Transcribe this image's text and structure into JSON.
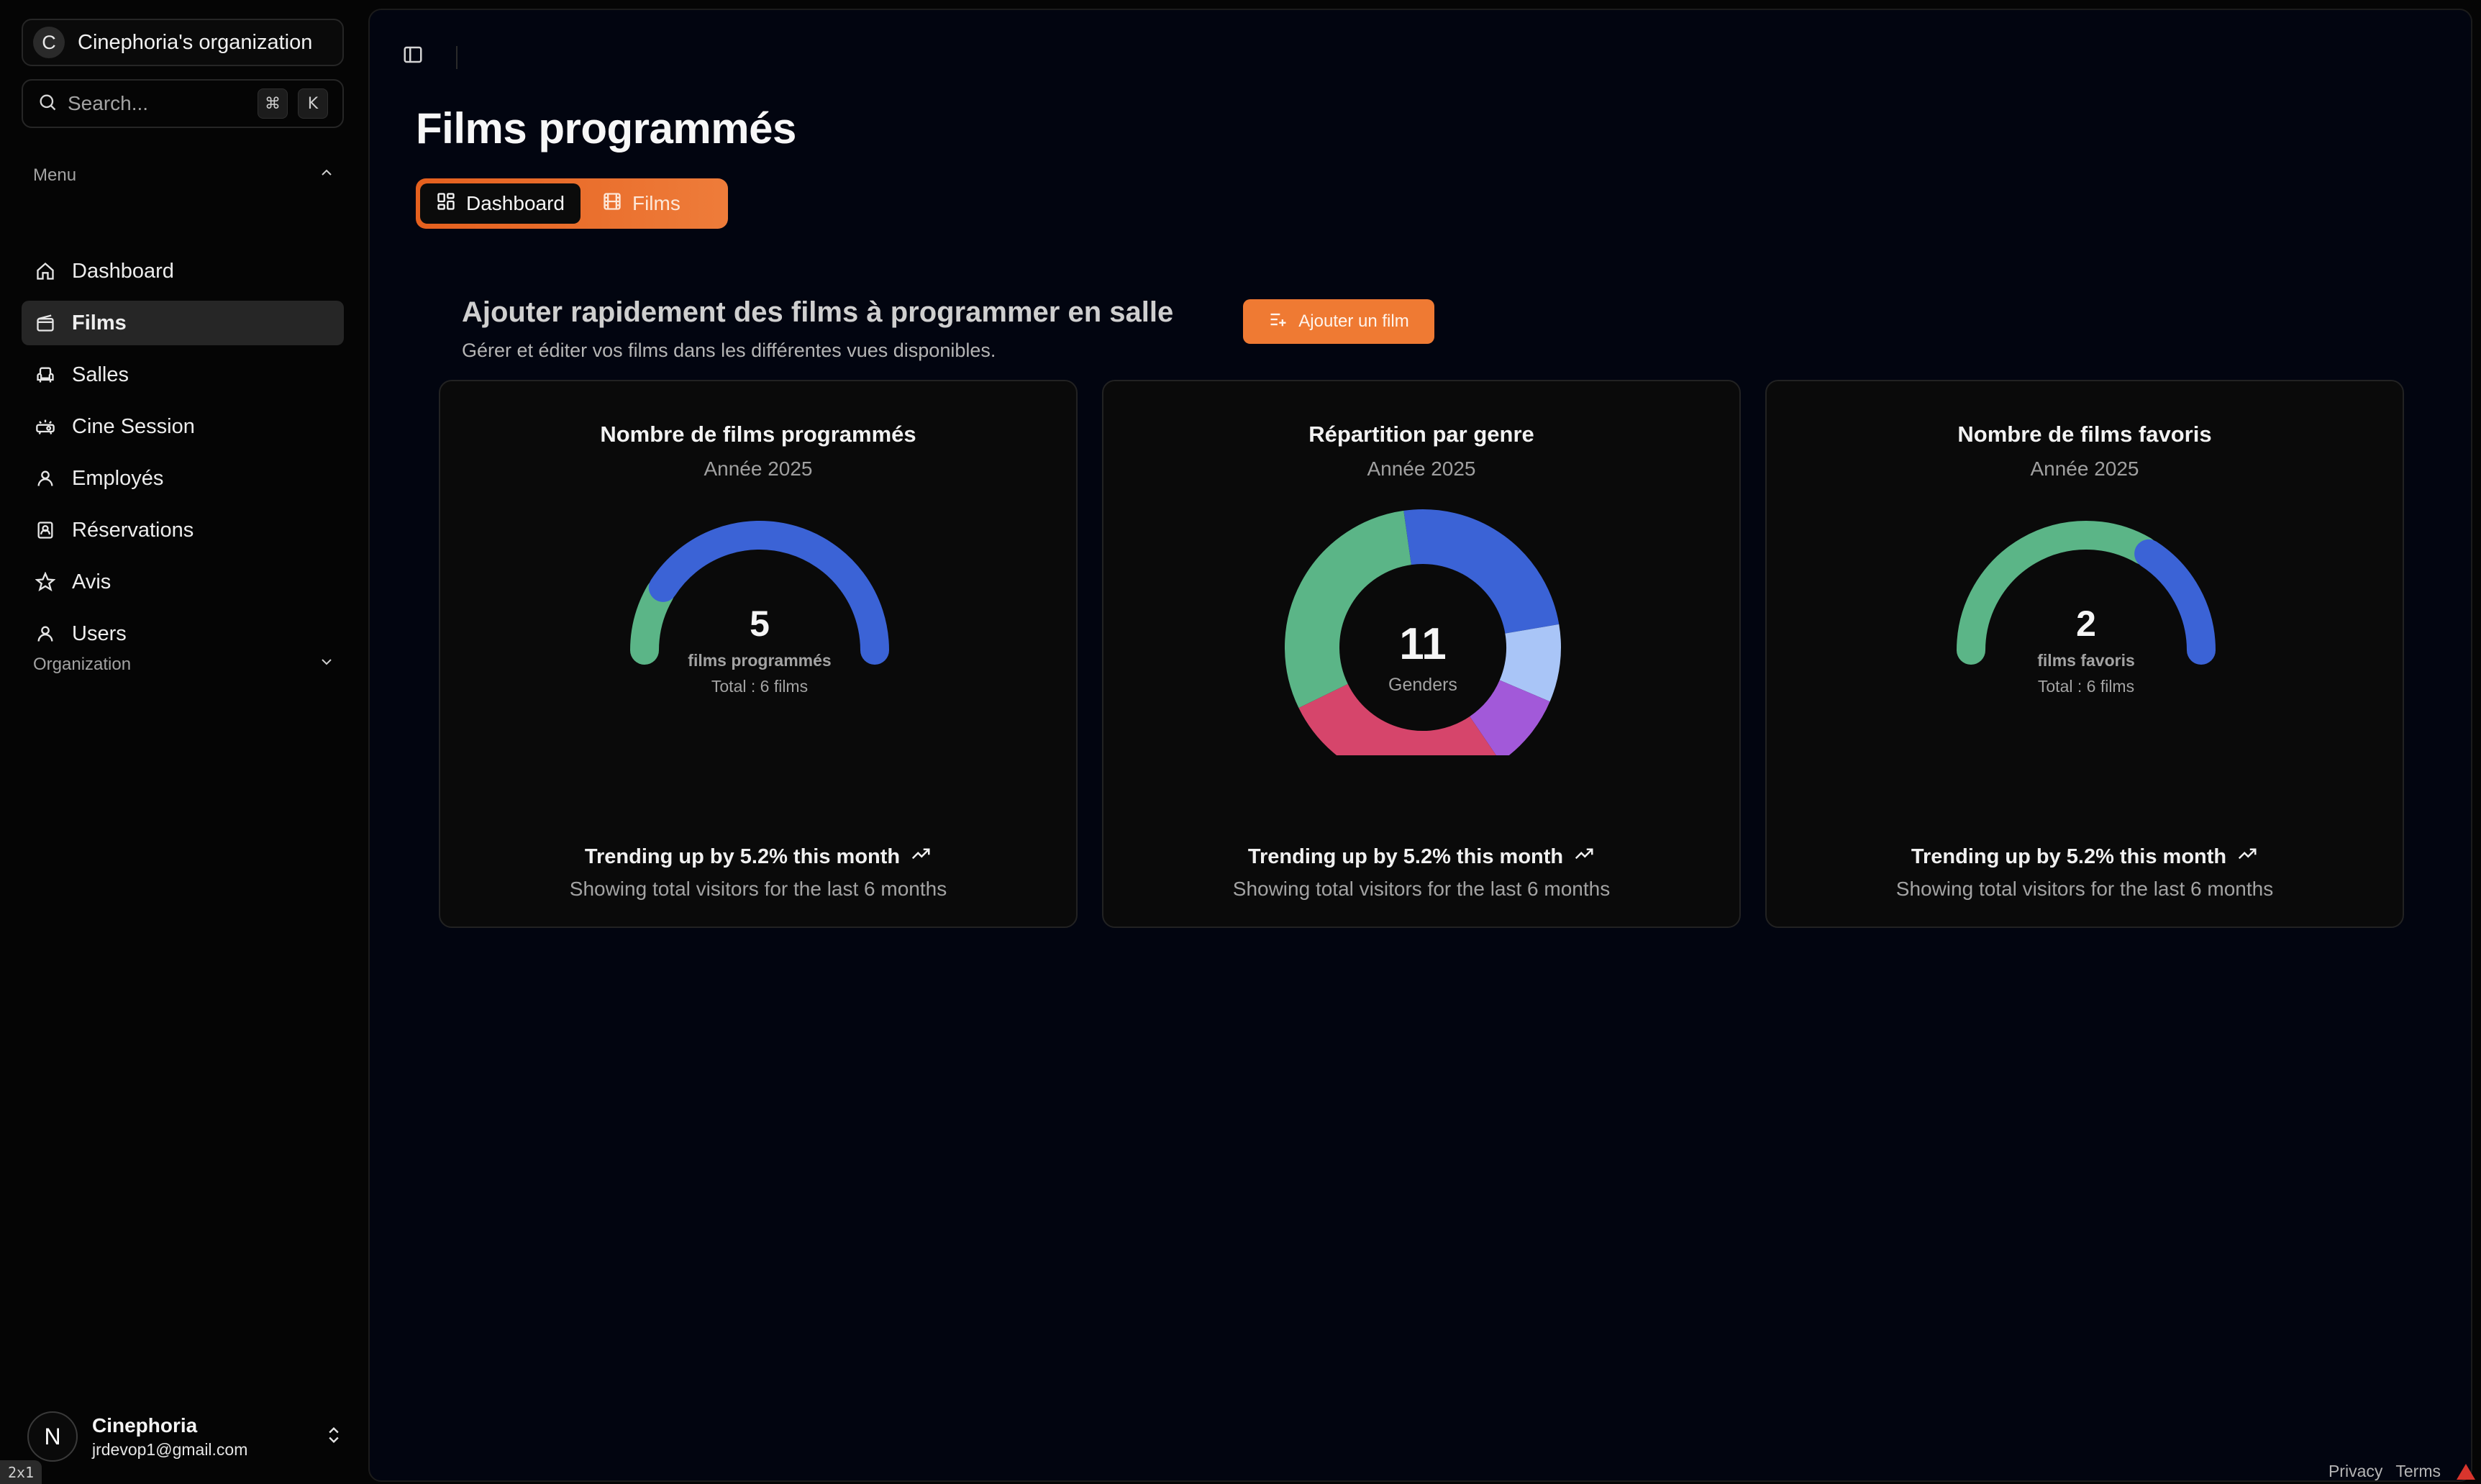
{
  "sidebar": {
    "org": {
      "initial": "C",
      "name": "Cinephoria's organization"
    },
    "search": {
      "placeholder": "Search...",
      "kbd": [
        "⌘",
        "K"
      ]
    },
    "menu_label": "Menu",
    "items": [
      {
        "label": "Dashboard",
        "icon": "home-icon"
      },
      {
        "label": "Films",
        "icon": "film-icon",
        "active": true
      },
      {
        "label": "Salles",
        "icon": "armchair-icon"
      },
      {
        "label": "Cine Session",
        "icon": "projector-icon"
      },
      {
        "label": "Employés",
        "icon": "user-icon"
      },
      {
        "label": "Réservations",
        "icon": "contact-card-icon"
      },
      {
        "label": "Avis",
        "icon": "star-icon"
      },
      {
        "label": "Users",
        "icon": "user-icon"
      }
    ],
    "org_section_label": "Organization",
    "user": {
      "initial": "N",
      "name": "Cinephoria",
      "email": "jrdevop1@gmail.com"
    }
  },
  "badge": "2x1",
  "main": {
    "title": "Films programmés",
    "tabs": [
      {
        "label": "Dashboard",
        "active": true
      },
      {
        "label": "Films",
        "active": false
      }
    ],
    "hero": {
      "title": "Ajouter rapidement des films à programmer en salle",
      "subtitle": "Gérer et éditer vos films dans les différentes vues disponibles.",
      "add_button": "Ajouter un film"
    }
  },
  "colors": {
    "accent": "#ef7a33",
    "blue": "#3b63d6",
    "green": "#5bb587",
    "red": "#d6456b",
    "purple": "#a259d9",
    "lightblue": "#a9c5f7"
  },
  "chart_data": [
    {
      "type": "pie",
      "title": "Nombre de films programmés",
      "subtitle": "Année 2025",
      "center_value": "5",
      "center_label": "films programmés",
      "center_total": "Total : 6 films",
      "slices": [
        {
          "value": 1,
          "color": "#5bb587"
        },
        {
          "value": 5,
          "color": "#3b63d6"
        }
      ],
      "trend": "Trending up by 5.2% this month",
      "footer": "Showing total visitors for the last 6 months"
    },
    {
      "type": "pie",
      "title": "Répartition par genre",
      "subtitle": "Année 2025",
      "center_value": "11",
      "center_label": "Genders",
      "slices": [
        {
          "value": 2.7,
          "color": "#3b63d6"
        },
        {
          "value": 1.0,
          "color": "#a9c5f7"
        },
        {
          "value": 1.0,
          "color": "#a259d9"
        },
        {
          "value": 3.0,
          "color": "#d6456b"
        },
        {
          "value": 3.3,
          "color": "#5bb587"
        }
      ],
      "trend": "Trending up by 5.2% this month",
      "footer": "Showing total visitors for the last 6 months"
    },
    {
      "type": "pie",
      "title": "Nombre de films favoris",
      "subtitle": "Année 2025",
      "center_value": "2",
      "center_label": "films favoris",
      "center_total": "Total : 6 films",
      "slices": [
        {
          "value": 4,
          "color": "#5bb587"
        },
        {
          "value": 2,
          "color": "#3b63d6"
        }
      ],
      "trend": "Trending up by 5.2% this month",
      "footer": "Showing total visitors for the last 6 months"
    }
  ],
  "footer": {
    "privacy": "Privacy",
    "terms": "Terms"
  }
}
